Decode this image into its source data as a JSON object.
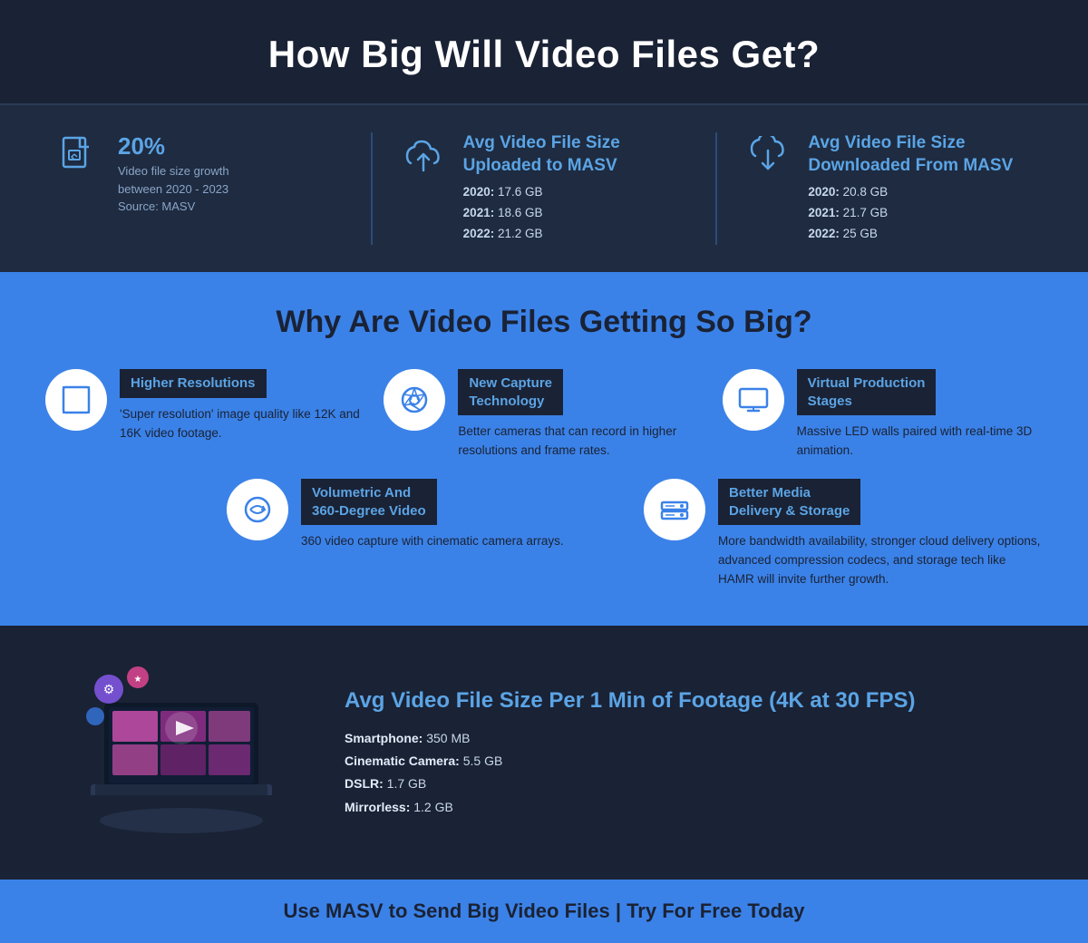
{
  "header": {
    "title": "How Big Will Video Files Get?"
  },
  "stats": {
    "growth": {
      "percent": "20%",
      "desc_line1": "Video file size growth",
      "desc_line2": "between 2020 - 2023",
      "source": "Source: MASV"
    },
    "uploaded": {
      "title_line1": "Avg Video File Size",
      "title_line2": "Uploaded to MASV",
      "rows": [
        {
          "year": "2020:",
          "value": "17.6 GB"
        },
        {
          "year": "2021:",
          "value": "18.6 GB"
        },
        {
          "year": "2022:",
          "value": "21.2 GB"
        }
      ]
    },
    "downloaded": {
      "title_line1": "Avg Video File Size",
      "title_line2": "Downloaded From MASV",
      "rows": [
        {
          "year": "2020:",
          "value": "20.8 GB"
        },
        {
          "year": "2021:",
          "value": "21.7 GB"
        },
        {
          "year": "2022:",
          "value": "25 GB"
        }
      ]
    }
  },
  "why": {
    "title": "Why Are Video Files Getting So Big?",
    "items": [
      {
        "id": "higher-res",
        "badge": "Higher Resolutions",
        "desc": "'Super resolution' image quality like 12K and 16K video footage."
      },
      {
        "id": "new-capture",
        "badge_line1": "New Capture",
        "badge_line2": "Technology",
        "desc": "Better cameras that can record in higher resolutions and frame rates."
      },
      {
        "id": "virtual-prod",
        "badge_line1": "Virtual Production",
        "badge_line2": "Stages",
        "desc": "Massive LED walls paired with real-time 3D animation."
      },
      {
        "id": "volumetric",
        "badge_line1": "Volumetric And",
        "badge_line2": "360-Degree Video",
        "desc": "360 video capture with cinematic camera arrays."
      },
      {
        "id": "better-media",
        "badge_line1": "Better Media",
        "badge_line2": "Delivery & Storage",
        "desc": "More bandwidth availability, stronger cloud delivery options, advanced compression codecs, and storage tech like HAMR will invite further growth."
      }
    ]
  },
  "bottom": {
    "title": "Avg Video File Size Per 1 Min of Footage (4K at 30 FPS)",
    "rows": [
      {
        "label": "Smartphone:",
        "value": "350 MB"
      },
      {
        "label": "Cinematic Camera:",
        "value": "5.5 GB"
      },
      {
        "label": "DSLR:",
        "value": "1.7 GB"
      },
      {
        "label": "Mirrorless:",
        "value": "1.2 GB"
      }
    ]
  },
  "footer": {
    "text": "Use MASV to Send Big Video Files | Try For Free Today"
  }
}
